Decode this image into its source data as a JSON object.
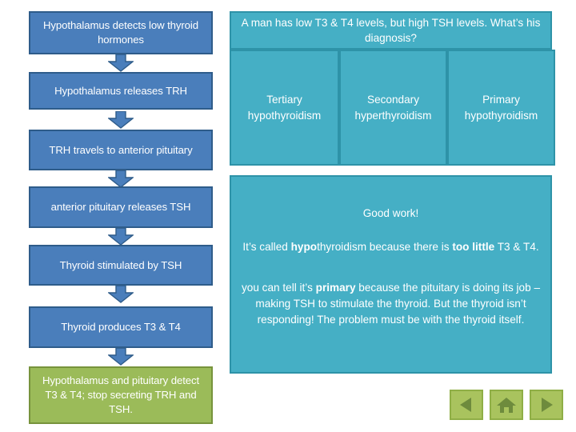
{
  "flowchart": {
    "steps": [
      {
        "text": "Hypothalamus detects low thyroid hormones",
        "color": "#4A7EBB"
      },
      {
        "text": "Hypothalamus releases TRH",
        "color": "#4A7EBB"
      },
      {
        "text": "TRH travels to anterior pituitary",
        "color": "#4A7EBB"
      },
      {
        "text": "anterior pituitary releases TSH",
        "color": "#4A7EBB"
      },
      {
        "text": "Thyroid stimulated by TSH",
        "color": "#4A7EBB"
      },
      {
        "text": "Thyroid produces T3 & T4",
        "color": "#4A7EBB"
      },
      {
        "text": "Hypothalamus and pituitary detect T3 & T4; stop secreting TRH and TSH.",
        "color": "#9BBB59"
      }
    ]
  },
  "quiz": {
    "question": "A man has low T3 & T4 levels, but high TSH levels. What’s his diagnosis?",
    "options": [
      "Tertiary hypothyroidism",
      "Secondary hyperthyroidism",
      "Primary hypothyroidism"
    ]
  },
  "feedback": {
    "title": "Good work!",
    "para_1_a": "It’s called ",
    "para_1_b": "hypo",
    "para_1_c": "thyroidism because there is ",
    "para_1_d": "too little",
    "para_1_e": " T3 & T4.",
    "para_2_a": "you can tell it’s ",
    "para_2_b": "primary",
    "para_2_c": " because the pituitary is doing its job – making TSH to stimulate the thyroid. But the thyroid isn’t responding!  The problem must be with the thyroid itself."
  },
  "nav": {
    "back_label": "back-arrow-icon",
    "home_label": "home-icon",
    "forward_label": "forward-arrow-icon"
  },
  "colors": {
    "flow_blue": "#4A7EBB",
    "flow_blue_border": "#2E5C8A",
    "flow_green": "#9BBB59",
    "flow_green_border": "#77933C",
    "teal": "#45AFC5",
    "teal_border": "#2E93A8",
    "nav_green": "#A9C35E",
    "nav_green_dark": "#6E8B3D"
  }
}
